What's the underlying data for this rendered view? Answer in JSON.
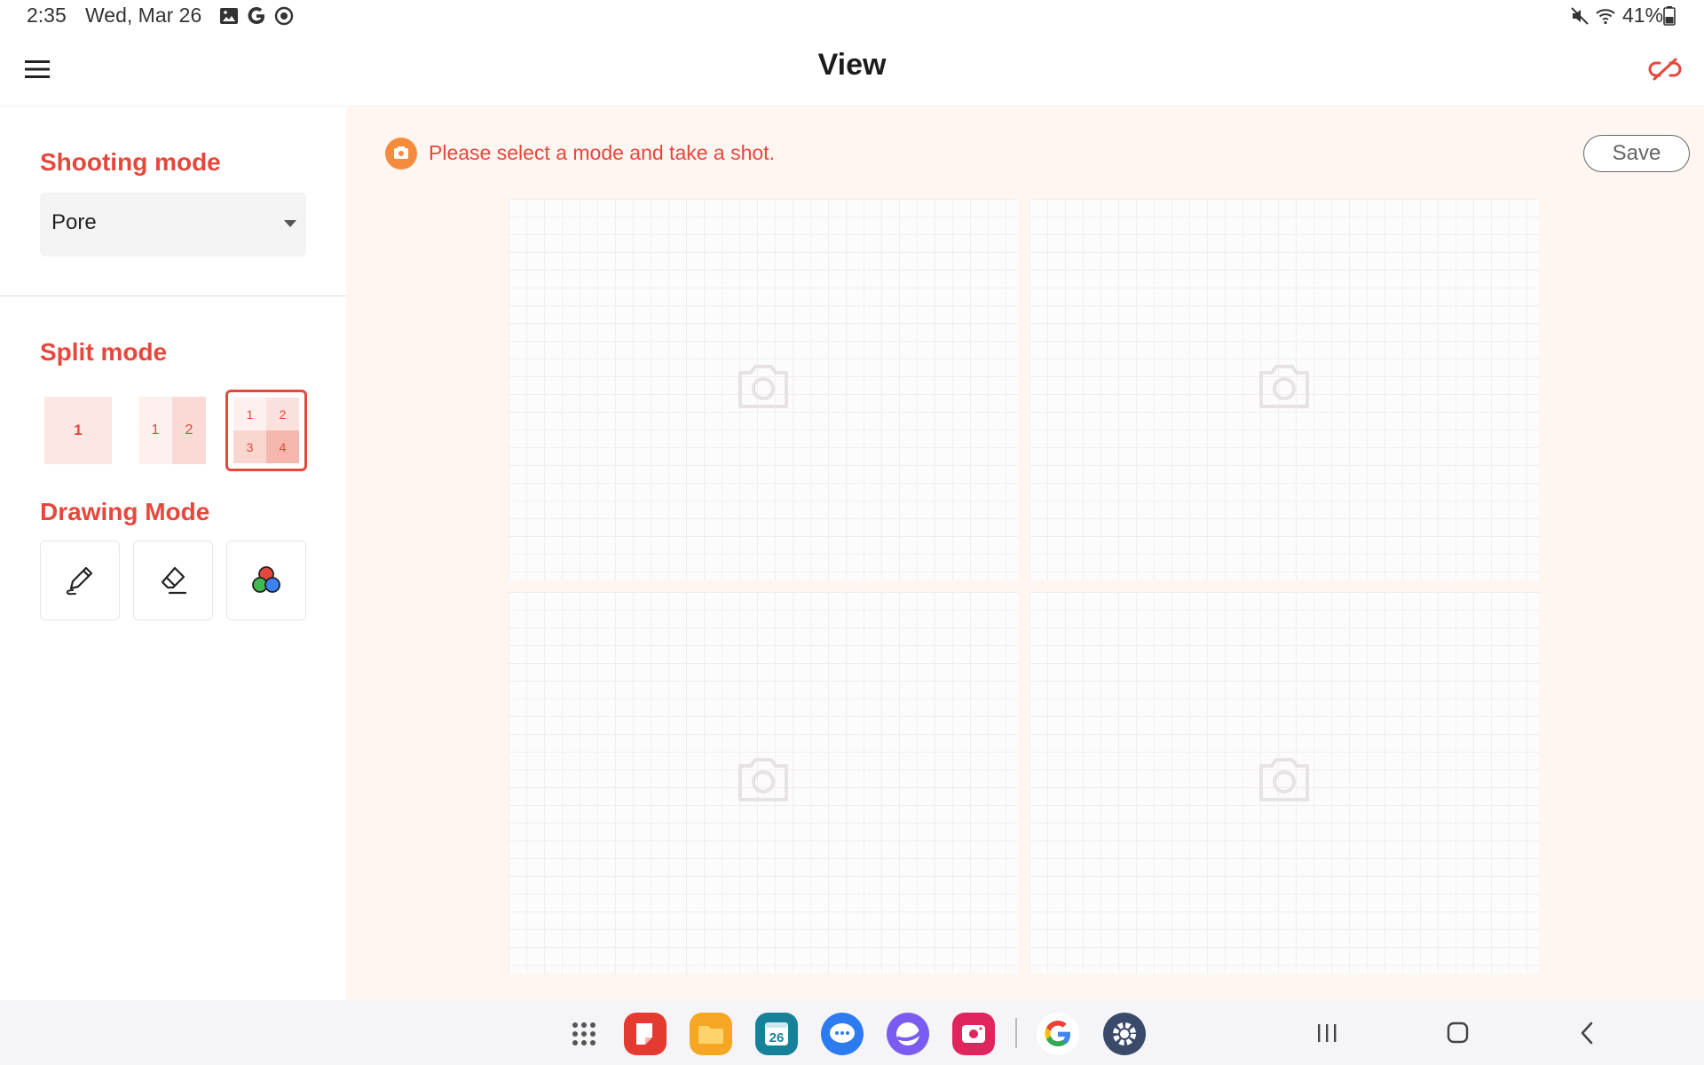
{
  "status_bar": {
    "time": "2:35",
    "date": "Wed, Mar 26",
    "battery": "41%"
  },
  "app_bar": {
    "title": "View"
  },
  "sidebar": {
    "shooting_mode": {
      "title": "Shooting mode",
      "selected": "Pore"
    },
    "split_mode": {
      "title": "Split mode",
      "options": [
        {
          "cells": [
            "1"
          ],
          "selected": false
        },
        {
          "cells": [
            "1",
            "2"
          ],
          "selected": false
        },
        {
          "cells": [
            "1",
            "2",
            "3",
            "4"
          ],
          "selected": true
        }
      ]
    },
    "drawing_mode": {
      "title": "Drawing Mode",
      "tools": [
        "pen-icon",
        "eraser-icon",
        "color-palette-icon"
      ]
    }
  },
  "main": {
    "notice": "Please select a mode and take a shot.",
    "save_label": "Save",
    "panels": 4
  },
  "dock": {
    "calendar_day": "26",
    "apps": [
      "app-drawer-icon",
      "notes-app-icon",
      "files-app-icon",
      "calendar-app-icon",
      "messages-app-icon",
      "internet-app-icon",
      "screen-recorder-app-icon",
      "google-app-icon",
      "settings-app-icon"
    ]
  },
  "colors": {
    "accent": "#e5473c",
    "notice_icon": "#f58c3d",
    "main_bg": "#fff6f1"
  }
}
